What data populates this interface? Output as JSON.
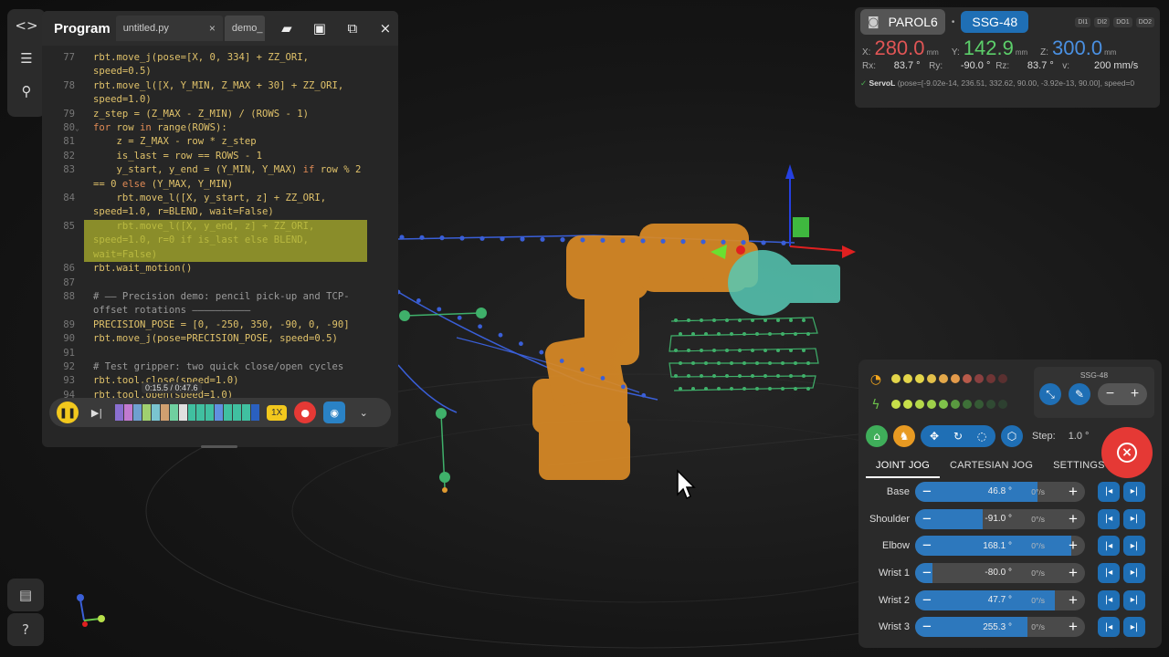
{
  "editor": {
    "title": "Program",
    "tabs": [
      {
        "label": "untitled.py",
        "close": "×"
      },
      {
        "label": "demo_"
      }
    ],
    "icons": [
      "folder-icon",
      "save-icon",
      "copy-icon",
      "close-icon"
    ],
    "close_glyph": "×",
    "lines": [
      {
        "n": "77",
        "parts": [
          [
            "t",
            "rbt.move_j(pose=[X, 0, 334] + ZZ_ORI,"
          ]
        ]
      },
      {
        "n": "",
        "parts": [
          [
            "t",
            "speed=0.5)"
          ]
        ]
      },
      {
        "n": "78",
        "parts": [
          [
            "t",
            "rbt.move_l([X, Y_MIN, Z_MAX + 30] + ZZ_ORI,"
          ]
        ]
      },
      {
        "n": "",
        "parts": [
          [
            "t",
            "speed=1.0)"
          ]
        ]
      },
      {
        "n": "79",
        "parts": [
          [
            "t",
            "z_step = (Z_MAX - Z_MIN) / (ROWS - 1)"
          ]
        ]
      },
      {
        "n": "80",
        "fold": "⌄",
        "parts": [
          [
            "kw",
            "for"
          ],
          [
            "t",
            " row "
          ],
          [
            "kw",
            "in"
          ],
          [
            "t",
            " range(ROWS):"
          ]
        ]
      },
      {
        "n": "81",
        "parts": [
          [
            "t",
            "    z = Z_MAX - row * z_step"
          ]
        ]
      },
      {
        "n": "82",
        "parts": [
          [
            "t",
            "    is_last = row == ROWS - 1"
          ]
        ]
      },
      {
        "n": "83",
        "parts": [
          [
            "t",
            "    y_start, y_end = (Y_MIN, Y_MAX) "
          ],
          [
            "kw",
            "if"
          ],
          [
            "t",
            " row % 2"
          ]
        ]
      },
      {
        "n": "",
        "parts": [
          [
            "t",
            "== 0 "
          ],
          [
            "kw",
            "else"
          ],
          [
            "t",
            " (Y_MAX, Y_MIN)"
          ]
        ]
      },
      {
        "n": "84",
        "parts": [
          [
            "t",
            "    rbt.move_l([X, y_start, z] + ZZ_ORI,"
          ]
        ]
      },
      {
        "n": "",
        "parts": [
          [
            "t",
            "speed=1.0, r=BLEND, wait=False)"
          ]
        ]
      },
      {
        "n": "85",
        "hl": true,
        "parts": [
          [
            "t",
            "    rbt.move_l([X, y_end, z] + ZZ_ORI,"
          ]
        ]
      },
      {
        "n": "",
        "hl": true,
        "parts": [
          [
            "t",
            "speed=1.0, r=0 if is_last else BLEND,"
          ]
        ]
      },
      {
        "n": "",
        "hl": true,
        "parts": [
          [
            "t",
            "wait=False)"
          ]
        ]
      },
      {
        "n": "86",
        "parts": [
          [
            "t",
            "rbt.wait_motion()"
          ]
        ]
      },
      {
        "n": "87",
        "parts": [
          [
            "t",
            ""
          ]
        ]
      },
      {
        "n": "88",
        "parts": [
          [
            "cm",
            "# —— Precision demo: pencil pick-up and TCP-"
          ]
        ]
      },
      {
        "n": "",
        "parts": [
          [
            "cm",
            "offset rotations ——————————"
          ]
        ]
      },
      {
        "n": "89",
        "parts": [
          [
            "t",
            "PRECISION_POSE = [0, -250, 350, -90, 0, -90]"
          ]
        ]
      },
      {
        "n": "90",
        "parts": [
          [
            "t",
            "rbt.move_j(pose=PRECISION_POSE, speed=0.5)"
          ]
        ]
      },
      {
        "n": "91",
        "parts": [
          [
            "t",
            ""
          ]
        ]
      },
      {
        "n": "92",
        "parts": [
          [
            "cm",
            "# Test gripper: two quick close/open cycles"
          ]
        ]
      },
      {
        "n": "93",
        "parts": [
          [
            "t",
            "rbt.tool.close(speed=1.0)"
          ]
        ]
      },
      {
        "n": "94",
        "parts": [
          [
            "t",
            "rbt.tool.open(speed=1.0)"
          ]
        ]
      }
    ],
    "time_tooltip": "0:15.5 / 0:47.6",
    "player": {
      "speed": "1X",
      "progress": 0.25,
      "icons": [
        "pause-icon",
        "step-forward-icon",
        "record-icon",
        "camera-icon",
        "chevron-down-icon"
      ]
    }
  },
  "rail": {
    "icons": [
      "code-icon",
      "sliders-icon",
      "gripper-icon"
    ],
    "bottom_icons": [
      "log-icon",
      "help-icon"
    ]
  },
  "status": {
    "robot": "PAROL6",
    "gripper": "SSG-48",
    "io": [
      "DI1",
      "DI2",
      "DO1",
      "DO2"
    ],
    "x": {
      "label": "X:",
      "value": "280.0",
      "unit": "mm",
      "color": "#e05555"
    },
    "y": {
      "label": "Y:",
      "value": "142.9",
      "unit": "mm",
      "color": "#5ccf6a"
    },
    "z": {
      "label": "Z:",
      "value": "300.0",
      "unit": "mm",
      "color": "#4a90e2"
    },
    "rx": {
      "label": "Rx:",
      "value": "83.7 °"
    },
    "ry": {
      "label": "Ry:",
      "value": "-90.0 °"
    },
    "rz": {
      "label": "Rz:",
      "value": "83.7 °"
    },
    "v": {
      "label": "v:",
      "value": "200 mm/s"
    },
    "servo_label": "ServoL",
    "servo_text": "(pose=[-9.02e-14, 236.51, 332.62, 90.00, -3.92e-13, 90.00], speed=0"
  },
  "jog": {
    "gripper_label": "SSG-48",
    "step_label": "Step:",
    "step_value": "1.0 °",
    "tabs": [
      "JOINT JOG",
      "CARTESIAN JOG",
      "SETTINGS"
    ],
    "speed_dots": [
      "#e3d54a",
      "#e3d54a",
      "#e3d54a",
      "#e3c04a",
      "#e3a84a",
      "#e39a4a",
      "#b85a4a",
      "#8a4040",
      "#703535",
      "#5a3030"
    ],
    "accel_dots": [
      "#c8e04a",
      "#c8e04a",
      "#b5d84a",
      "#9ed04a",
      "#7fc24a",
      "#5a9a40",
      "#3e7038",
      "#355a35",
      "#304a33",
      "#2d4030"
    ],
    "joints": [
      {
        "name": "Base",
        "value": "46.8 °",
        "speed": "0°/s",
        "fill": 0.72
      },
      {
        "name": "Shoulder",
        "value": "-91.0 °",
        "speed": "0°/s",
        "fill": 0.4
      },
      {
        "name": "Elbow",
        "value": "168.1 °",
        "speed": "0°/s",
        "fill": 0.92
      },
      {
        "name": "Wrist 1",
        "value": "-80.0 °",
        "speed": "0°/s",
        "fill": 0.1
      },
      {
        "name": "Wrist 2",
        "value": "47.7 °",
        "speed": "0°/s",
        "fill": 0.82
      },
      {
        "name": "Wrist 3",
        "value": "255.3 °",
        "speed": "0°/s",
        "fill": 0.66
      }
    ]
  }
}
